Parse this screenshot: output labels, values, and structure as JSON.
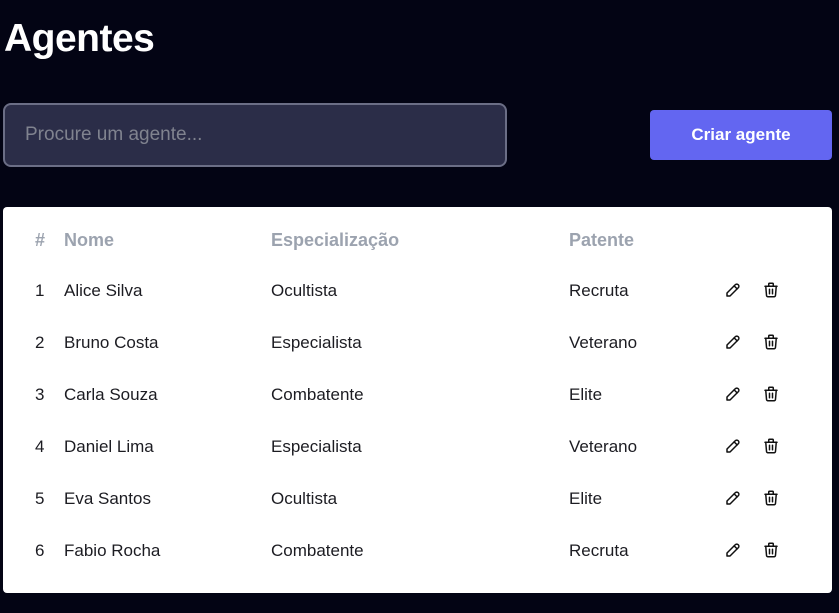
{
  "page": {
    "title": "Agentes"
  },
  "search": {
    "placeholder": "Procure um agente...",
    "value": ""
  },
  "toolbar": {
    "create_label": "Criar agente"
  },
  "table": {
    "headers": {
      "num": "#",
      "name": "Nome",
      "specialization": "Especialização",
      "rank": "Patente"
    },
    "rows": [
      {
        "num": "1",
        "name": "Alice Silva",
        "specialization": "Ocultista",
        "rank": "Recruta"
      },
      {
        "num": "2",
        "name": "Bruno Costa",
        "specialization": "Especialista",
        "rank": "Veterano"
      },
      {
        "num": "3",
        "name": "Carla Souza",
        "specialization": "Combatente",
        "rank": "Elite"
      },
      {
        "num": "4",
        "name": "Daniel Lima",
        "specialization": "Especialista",
        "rank": "Veterano"
      },
      {
        "num": "5",
        "name": "Eva Santos",
        "specialization": "Ocultista",
        "rank": "Elite"
      },
      {
        "num": "6",
        "name": "Fabio Rocha",
        "specialization": "Combatente",
        "rank": "Recruta"
      }
    ],
    "row_actions": {
      "edit_icon": "pencil-icon",
      "delete_icon": "trash-icon"
    }
  },
  "colors": {
    "background": "#030414",
    "accent": "#6366f1",
    "header_text": "#9ca3af",
    "input_background": "#2b2d48"
  }
}
